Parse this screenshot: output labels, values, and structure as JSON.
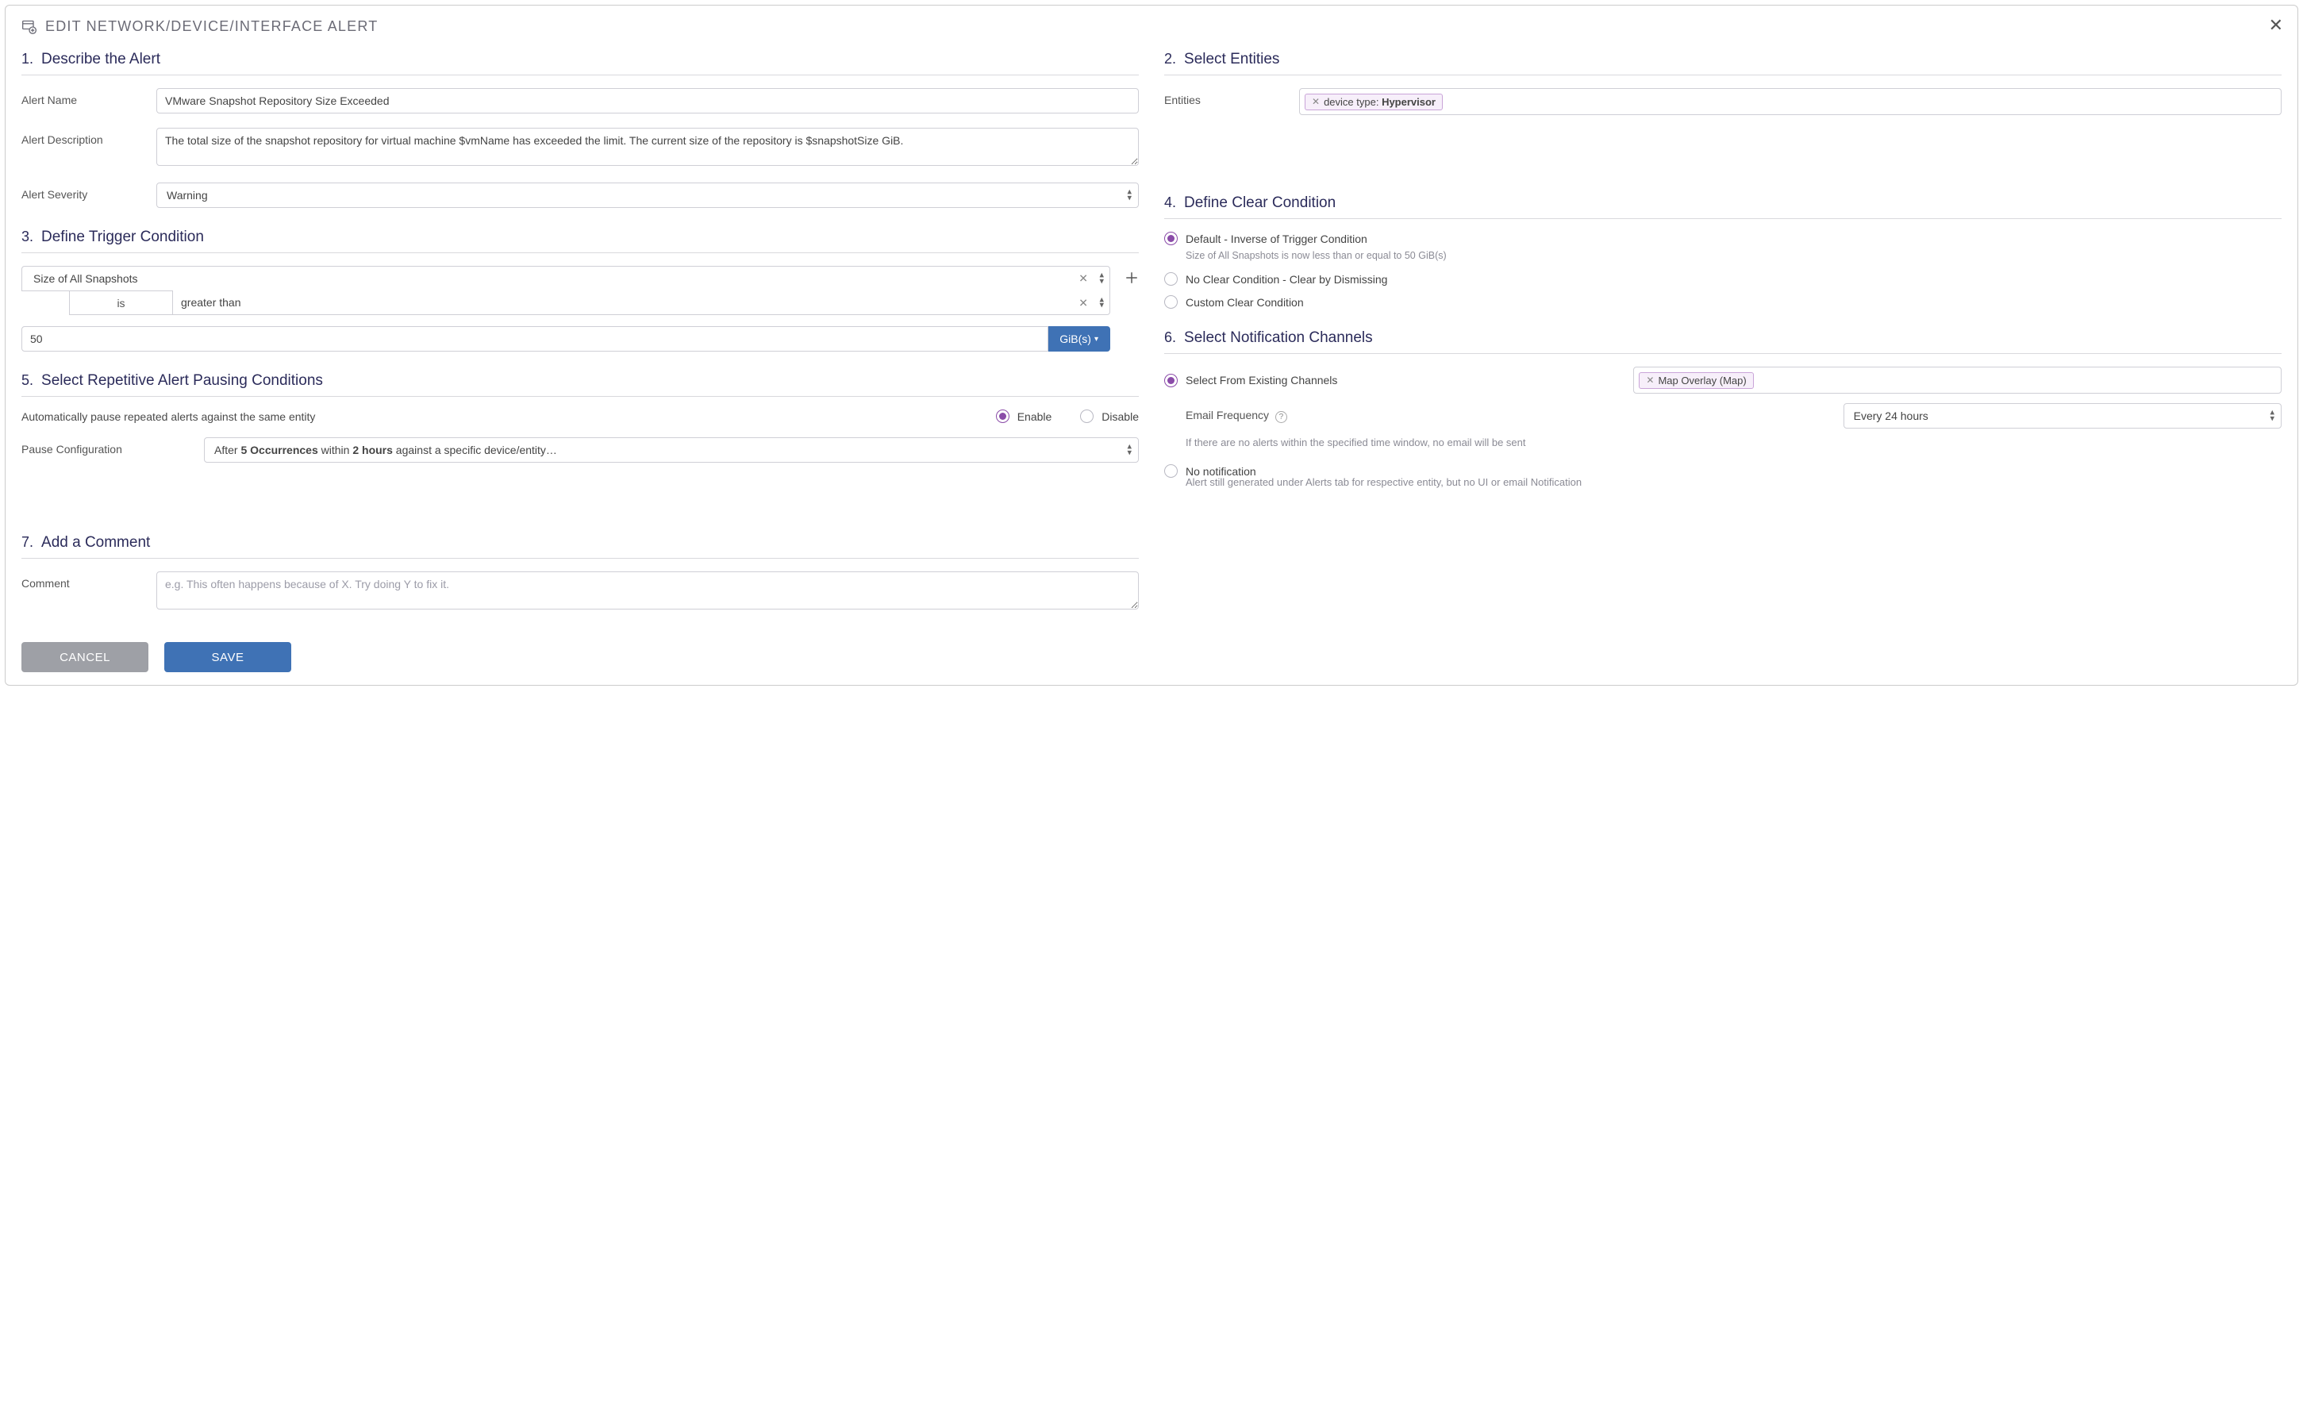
{
  "window": {
    "title": "EDIT NETWORK/DEVICE/INTERFACE ALERT"
  },
  "section1": {
    "num": "1.",
    "title": "Describe the Alert",
    "alert_name_label": "Alert Name",
    "alert_name_value": "VMware Snapshot Repository Size Exceeded",
    "alert_desc_label": "Alert Description",
    "alert_desc_value": "The total size of the snapshot repository for virtual machine $vmName has exceeded the limit. The current size of the repository is $snapshotSize GiB.",
    "alert_sev_label": "Alert Severity",
    "alert_sev_value": "Warning"
  },
  "section2": {
    "num": "2.",
    "title": "Select Entities",
    "entities_label": "Entities",
    "chip_prefix": "device type: ",
    "chip_value": "Hypervisor"
  },
  "section3": {
    "num": "3.",
    "title": "Define Trigger Condition",
    "metric": "Size of All Snapshots",
    "is_text": "is",
    "op": "greater than",
    "value": "50",
    "unit": "GiB(s)"
  },
  "section4": {
    "num": "4.",
    "title": "Define Clear Condition",
    "opt_default": "Default - Inverse of Trigger Condition",
    "default_note": "Size of All Snapshots is now less than or equal to 50 GiB(s)",
    "opt_noclear": "No Clear Condition - Clear by Dismissing",
    "opt_custom": "Custom Clear Condition"
  },
  "section5": {
    "num": "5.",
    "title": "Select Repetitive Alert Pausing Conditions",
    "auto_label": "Automatically pause repeated alerts against the same entity",
    "enable": "Enable",
    "disable": "Disable",
    "pause_conf_label": "Pause Configuration",
    "pause_conf_prefix": "After ",
    "pause_conf_b1": "5 Occurrences",
    "pause_conf_mid": " within ",
    "pause_conf_b2": "2 hours",
    "pause_conf_suffix": " against a specific device/entity…"
  },
  "section6": {
    "num": "6.",
    "title": "Select Notification Channels",
    "opt_existing": "Select From Existing Channels",
    "chip": "Map Overlay (Map)",
    "email_freq_label": "Email Frequency",
    "email_freq_value": "Every 24 hours",
    "email_note": "If there are no alerts within the specified time window, no email will be sent",
    "opt_none": "No notification",
    "none_note": "Alert still generated under Alerts tab for respective entity, but no UI or email Notification"
  },
  "section7": {
    "num": "7.",
    "title": "Add a Comment",
    "comment_label": "Comment",
    "comment_placeholder": "e.g. This often happens because of X. Try doing Y to fix it."
  },
  "buttons": {
    "cancel": "CANCEL",
    "save": "SAVE"
  }
}
